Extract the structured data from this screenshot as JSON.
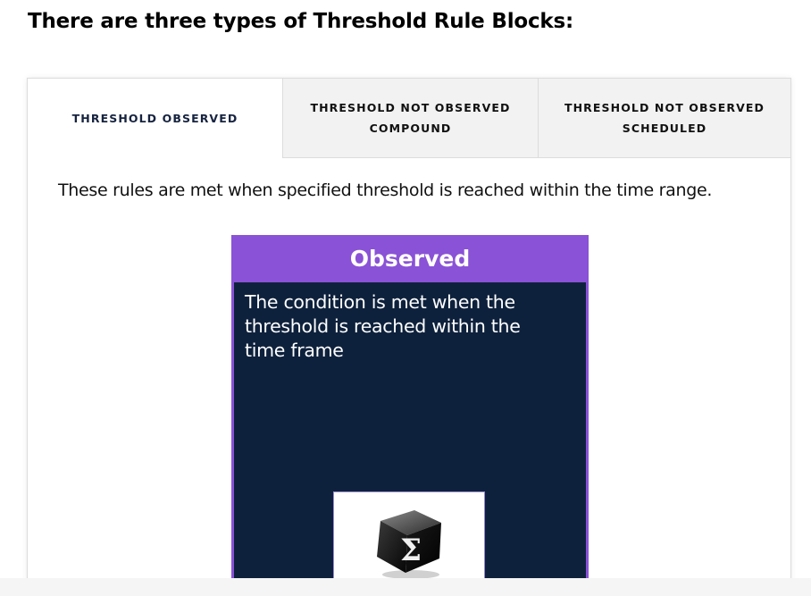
{
  "heading": "There are three types of Threshold Rule Blocks:",
  "tabs": [
    {
      "label": "THRESHOLD OBSERVED",
      "active": true
    },
    {
      "label": "THRESHOLD NOT OBSERVED\nCOMPOUND",
      "active": false
    },
    {
      "label": "THRESHOLD NOT OBSERVED\nSCHEDULED",
      "active": false
    }
  ],
  "description": "These rules are met when specified threshold is reached within the time range.",
  "card": {
    "title": "Observed",
    "body": "The condition is met when the threshold is reached within the time frame",
    "icon": "sigma-cube-icon"
  },
  "colors": {
    "accent_purple": "#8a52d6",
    "card_background": "#0e213c",
    "active_tab_text": "#16233f",
    "inactive_tab_bg": "#f2f2f2"
  }
}
